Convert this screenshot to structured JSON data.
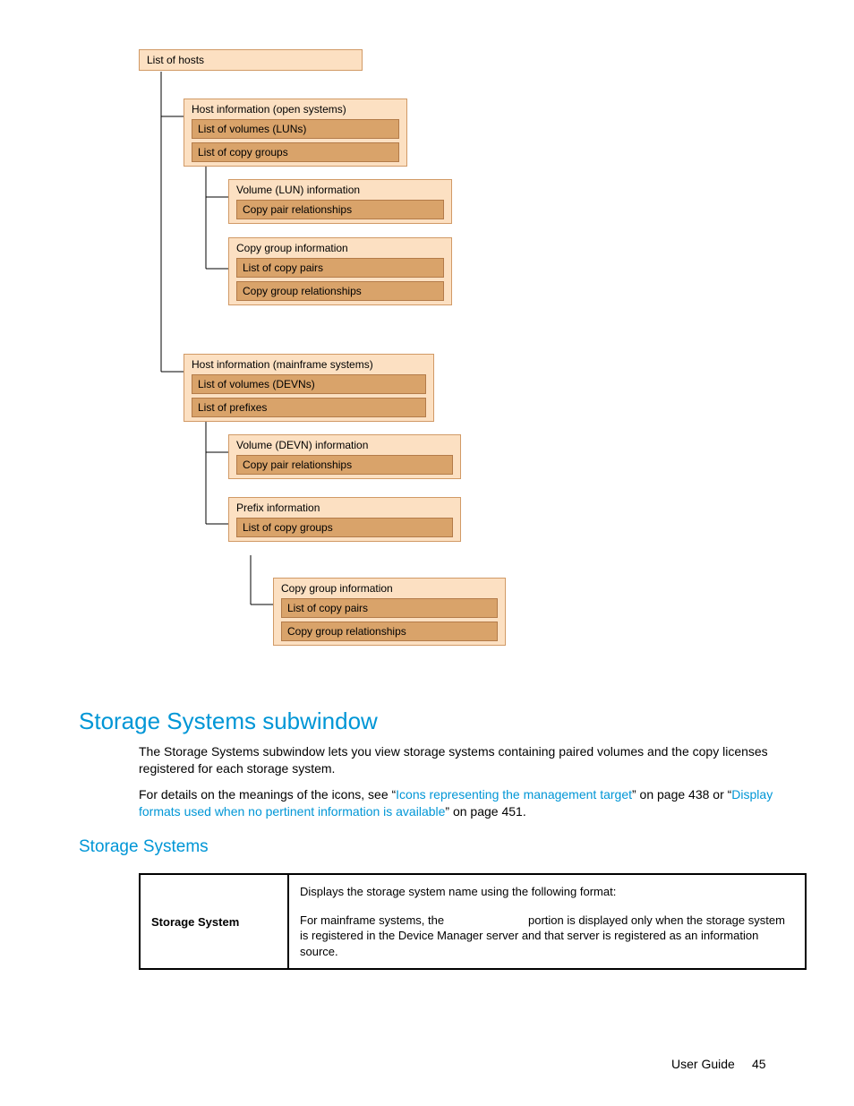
{
  "diagram": {
    "root": "List of hosts",
    "host_open": {
      "title": "Host information (open systems)",
      "rows": [
        "List of volumes (LUNs)",
        "List of copy groups"
      ]
    },
    "vol_lun": {
      "title": "Volume (LUN) information",
      "rows": [
        "Copy pair relationships"
      ]
    },
    "copygroup1": {
      "title": "Copy group information",
      "rows": [
        "List of copy pairs",
        "Copy group relationships"
      ]
    },
    "host_mf": {
      "title": "Host information (mainframe systems)",
      "rows": [
        "List of volumes (DEVNs)",
        "List of prefixes"
      ]
    },
    "vol_devn": {
      "title": "Volume (DEVN) information",
      "rows": [
        "Copy pair relationships"
      ]
    },
    "prefix": {
      "title": "Prefix information",
      "rows": [
        "List of copy groups"
      ]
    },
    "copygroup2": {
      "title": "Copy group information",
      "rows": [
        "List of copy pairs",
        "Copy group relationships"
      ]
    }
  },
  "headings": {
    "h1": "Storage Systems subwindow",
    "h2": "Storage Systems"
  },
  "paragraphs": {
    "p1": "The Storage Systems subwindow lets you view storage systems containing paired volumes and the copy licenses registered for each storage system.",
    "p2a": "For details on the meanings of the icons, see “",
    "p2link1": "Icons representing the management target",
    "p2b": "” on page 438 or “",
    "p2link2": "Display formats used when no pertinent information is available",
    "p2c": "” on page 451."
  },
  "table": {
    "key": "Storage System",
    "line1": "Displays the storage system name using the following format:",
    "line2a": "For mainframe systems, the ",
    "line2b": " portion is displayed only when the storage system is registered in the Device Manager server and that server is registered as an information source."
  },
  "footer": {
    "label": "User Guide",
    "page": "45"
  }
}
